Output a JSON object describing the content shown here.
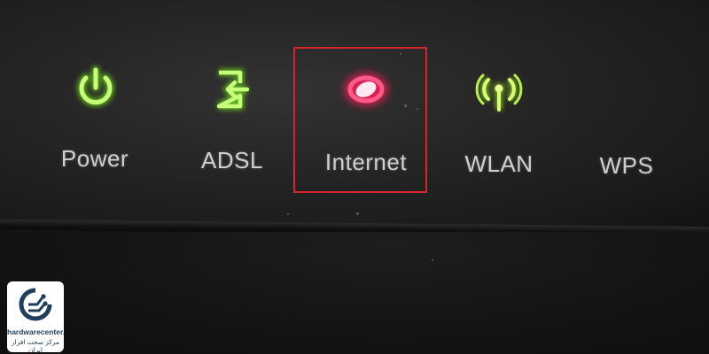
{
  "indicators": [
    {
      "label": "Power",
      "icon": "power-icon",
      "led_color": "#8be03a",
      "lit": true
    },
    {
      "label": "ADSL",
      "icon": "adsl-icon",
      "led_color": "#8be03a",
      "lit": true
    },
    {
      "label": "Internet",
      "icon": "internet-icon",
      "led_color": "#ff2b6e",
      "lit": true,
      "highlighted": true
    },
    {
      "label": "WLAN",
      "icon": "wlan-icon",
      "led_color": "#a6e42c",
      "lit": true
    },
    {
      "label": "WPS",
      "icon": "wps-icon",
      "lit": false
    }
  ],
  "highlight_color": "#d6262c",
  "watermark": {
    "brand": "hardwarecenter.ir",
    "tagline": "مرکز سخت افزار ایران",
    "icon": "circuit-logo-icon",
    "color": "#1f3d5c"
  }
}
